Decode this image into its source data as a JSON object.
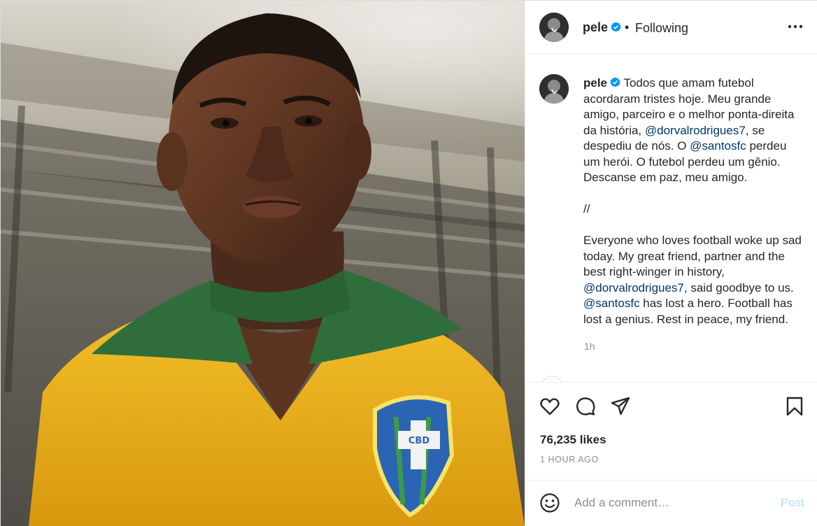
{
  "colors": {
    "text": "#262626",
    "secondary": "#8e8e8e",
    "mention": "#00376b",
    "verified": "#0095f6",
    "post_disabled": "#b2dffc",
    "jersey_yellow": "#f0b41e",
    "collar_green": "#2f6e3a"
  },
  "header": {
    "username": "pele",
    "separator": "•",
    "follow_status": "Following",
    "more_icon": "more-horizontal-icon"
  },
  "caption": {
    "username": "pele",
    "pt_1": "Todos que amam futebol acordaram tristes hoje. Meu grande amigo, parceiro e o melhor ponta-direita da história, ",
    "pt_mention_1": "@dorvalrodrigues7",
    "pt_2": ", se despediu de nós. O ",
    "pt_mention_2": "@santosfc",
    "pt_3": " perdeu um herói. O futebol perdeu um gênio. Descanse em paz, meu amigo.",
    "divider": "//",
    "en_1": "Everyone who loves football woke up sad today. My great friend, partner and the best right-winger in history, ",
    "en_mention_1": "@dorvalrodrigues7",
    "en_2": ", said goodbye to us. ",
    "en_mention_2": "@santosfc",
    "en_3": " has lost a hero. Football has lost a genius. Rest in peace, my friend.",
    "time_ago": "1h"
  },
  "actions": {
    "like_icon": "heart-icon",
    "comment_icon": "comment-icon",
    "share_icon": "paper-plane-icon",
    "save_icon": "bookmark-icon"
  },
  "likes_text": "76,235 likes",
  "posted_time": "1 HOUR AGO",
  "comment_box": {
    "emoji_icon": "smiley-icon",
    "placeholder": "Add a comment…",
    "post_label": "Post"
  },
  "photo": {
    "crest_text": "CBD"
  }
}
